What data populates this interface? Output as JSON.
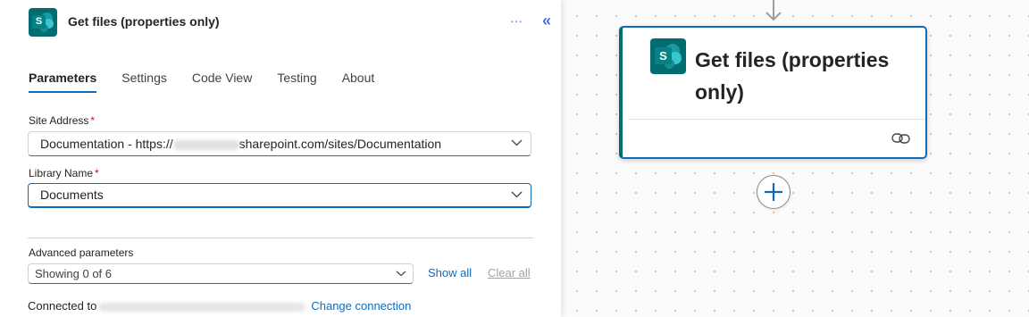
{
  "panel": {
    "title": "Get files (properties only)",
    "more_icon": "···",
    "collapse_icon": "«",
    "tabs": [
      {
        "label": "Parameters",
        "active": true
      },
      {
        "label": "Settings",
        "active": false
      },
      {
        "label": "Code View",
        "active": false
      },
      {
        "label": "Testing",
        "active": false
      },
      {
        "label": "About",
        "active": false
      }
    ],
    "site_address": {
      "label": "Site Address",
      "required_mark": "*",
      "value_prefix": "Documentation - https://",
      "value_suffix": "sharepoint.com/sites/Documentation"
    },
    "library_name": {
      "label": "Library Name",
      "required_mark": "*",
      "value": "Documents"
    },
    "advanced": {
      "label": "Advanced parameters",
      "selected": "Showing 0 of 6",
      "show_all": "Show all",
      "clear_all": "Clear all"
    },
    "connection": {
      "prefix": "Connected to",
      "change_link": "Change connection"
    }
  },
  "canvas": {
    "card": {
      "title": "Get files (properties only)",
      "icon": "sharepoint-icon",
      "link_icon": "link-icon"
    },
    "add_button_icon": "plus-icon"
  },
  "icons": {
    "sharepoint_letter": "S"
  },
  "colors": {
    "accent": "#0f6cbd",
    "sharepoint_teal": "#036c70",
    "required": "#c50f1f"
  }
}
